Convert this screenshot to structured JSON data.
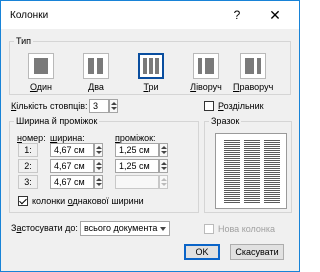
{
  "dialog": {
    "title": "Колонки",
    "help_label": "?",
    "close_label": "✕"
  },
  "type_group": {
    "label": "Тип"
  },
  "presets": [
    {
      "label": "Один",
      "accel": "О",
      "rest": "дин"
    },
    {
      "label": "Два",
      "accel": "Д",
      "rest": "ва"
    },
    {
      "label": "Три",
      "accel": "Т",
      "rest": "ри"
    },
    {
      "label": "Ліворуч",
      "accel": "Л",
      "rest": "іворуч"
    },
    {
      "label": "Праворуч",
      "accel": "П",
      "rest": "раворуч"
    }
  ],
  "selected_preset": "Три",
  "column_count": {
    "label_accel": "К",
    "label_rest": "ількість стовпців:",
    "value": "3"
  },
  "separator": {
    "label_accel": "Р",
    "label_rest": "оздільник",
    "checked": false
  },
  "width_group": {
    "label": "Ширина й проміжок",
    "header_number_accel": "н",
    "header_number_rest": "омер:",
    "header_width_accel": "ш",
    "header_width_rest": "ирина:",
    "header_spacing_accel": "п",
    "header_spacing_rest": "роміжок:",
    "rows": [
      {
        "num": "1:",
        "width": "4,67 см",
        "spacing": "1,25 см"
      },
      {
        "num": "2:",
        "width": "4,67 см",
        "spacing": "1,25 см"
      },
      {
        "num": "3:",
        "width": "4,67 см",
        "spacing": ""
      }
    ],
    "equal_width": {
      "label_pre": "колонки ",
      "label_accel": "о",
      "label_post": "днакової ширини",
      "checked": true
    }
  },
  "preview_group": {
    "label": "Зразок"
  },
  "apply_to": {
    "label_pre": "З",
    "label_accel": "а",
    "label_post": "стосувати до:",
    "value": "всього документа"
  },
  "new_column": {
    "label": "Нова колонка",
    "checked": false
  },
  "buttons": {
    "ok": "OK",
    "cancel": "Скасувати"
  }
}
